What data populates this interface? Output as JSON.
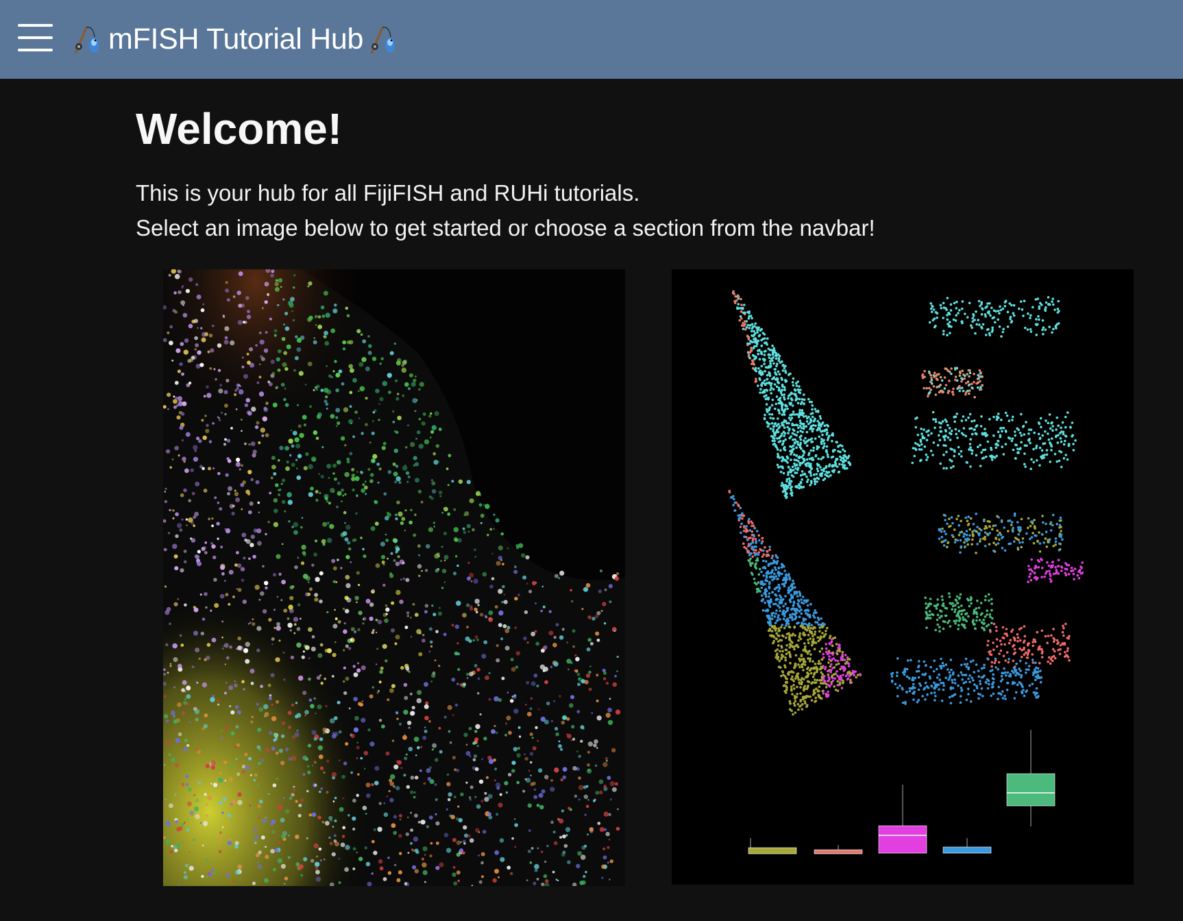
{
  "navbar": {
    "menu_icon": "hamburger-menu-icon",
    "brand_icon": "fishing-pole-fish-icon",
    "title": "mFISH Tutorial Hub",
    "accent_color": "#5a7799"
  },
  "main": {
    "title": "Welcome!",
    "intro_lines": [
      "This is your hub for all FijiFISH and RUHi tutorials.",
      "Select an image below to get started or choose a section from the navbar!"
    ]
  },
  "gallery": {
    "left_image": "mFISH microscopy fluorescence image",
    "right_image": "spatial cluster scatter plots and boxplot",
    "boxplot_colors": [
      "#a7a83a",
      "#e07a70",
      "#e13fe0",
      "#3b9be0",
      "#4cba7c"
    ]
  }
}
